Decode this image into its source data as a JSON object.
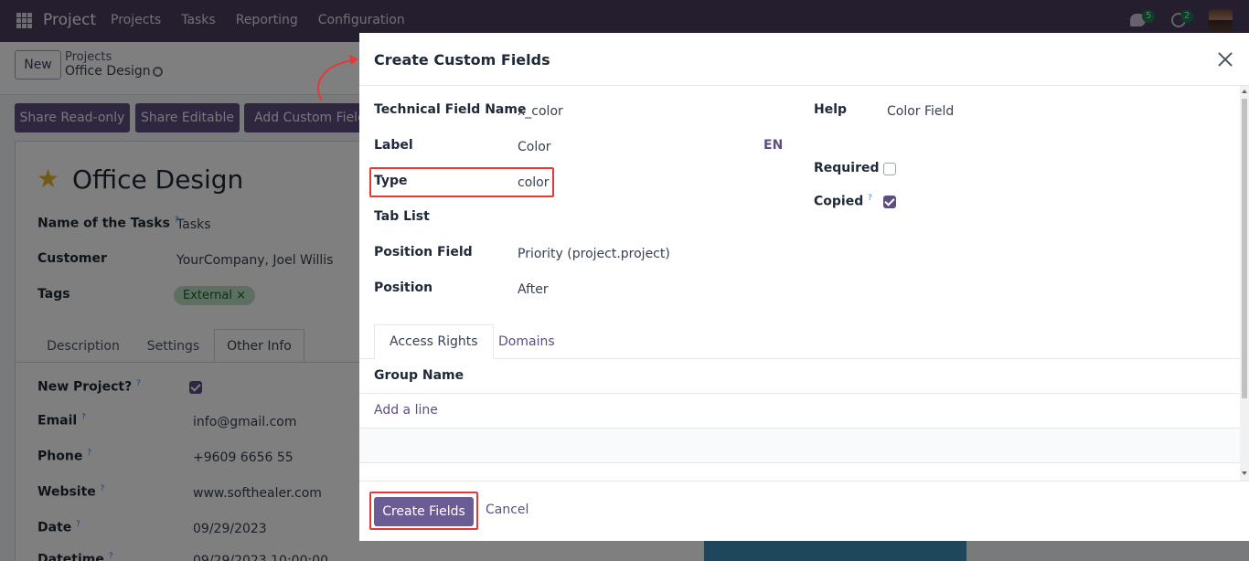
{
  "navbar": {
    "app_name": "Project",
    "menu": [
      "Projects",
      "Tasks",
      "Reporting",
      "Configuration"
    ],
    "chat_badge": "5",
    "activity_badge": "2"
  },
  "control_panel": {
    "new_label": "New",
    "breadcrumb_parent": "Projects",
    "breadcrumb_current": "Office Design",
    "actions": [
      "Share Read-only",
      "Share Editable",
      "Add Custom Field"
    ]
  },
  "record": {
    "title": "Office Design",
    "fields": [
      {
        "label": "Name of the Tasks",
        "help": "?",
        "value": "Tasks"
      },
      {
        "label": "Customer",
        "help": "",
        "value": "YourCompany, Joel Willis"
      },
      {
        "label": "Tags",
        "help": "",
        "value": ""
      }
    ],
    "tag": "External ×",
    "tabs": [
      "Description",
      "Settings",
      "Other Info"
    ],
    "other_info": [
      {
        "label": "New Project?",
        "help": "?",
        "value": ""
      },
      {
        "label": "Email",
        "help": "?",
        "value": "info@gmail.com"
      },
      {
        "label": "Phone",
        "help": "?",
        "value": "+9609 6656 55"
      },
      {
        "label": "Website",
        "help": "?",
        "value": "www.softhealer.com"
      },
      {
        "label": "Date",
        "help": "?",
        "value": "09/29/2023"
      },
      {
        "label": "Datetime",
        "help": "?",
        "value": "09/29/2023 10:00:00"
      }
    ]
  },
  "modal": {
    "title": "Create Custom Fields",
    "left_fields": [
      {
        "label": "Technical Field Name",
        "value": "x_color"
      },
      {
        "label": "Label",
        "value": "Color"
      },
      {
        "label": "Type",
        "value": "color"
      },
      {
        "label": "Tab List",
        "value": ""
      },
      {
        "label": "Position Field",
        "value": "Priority (project.project)"
      },
      {
        "label": "Position",
        "value": "After"
      }
    ],
    "lang_code": "EN",
    "help_label": "Help",
    "help_value": "Color Field",
    "required_label": "Required",
    "required_checked": false,
    "copied_label": "Copied",
    "copied_help": "?",
    "copied_checked": true,
    "tabs": [
      "Access Rights",
      "Domains"
    ],
    "group_name_header": "Group Name",
    "add_line": "Add a line",
    "create_button": "Create Fields",
    "cancel_button": "Cancel"
  },
  "colors": {
    "navbar": "#4a3d5c",
    "primary": "#6b5c96",
    "highlight": "#e53935"
  }
}
